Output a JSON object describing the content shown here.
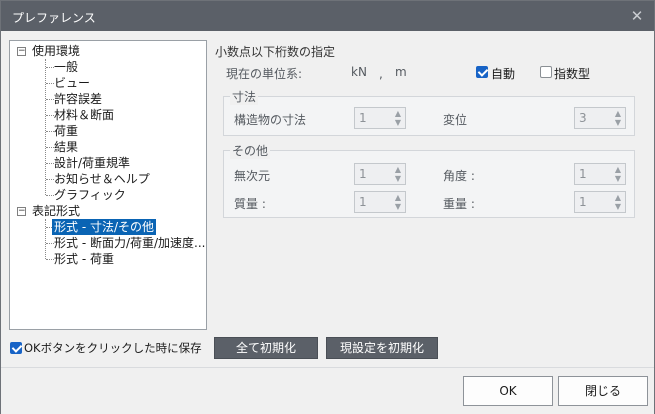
{
  "window": {
    "title": "プレファレンス"
  },
  "tree": {
    "root1": "使用環境",
    "root1_children": [
      "一般",
      "ビュー",
      "許容誤差",
      "材料＆断面",
      "荷重",
      "結果",
      "設計/荷重規準",
      "お知らせ＆ヘルプ",
      "グラフィック"
    ],
    "root2": "表記形式",
    "root2_children": [
      "形式 - 寸法/その他",
      "形式 - 断面力/荷重/加速度...",
      "形式 - 荷重"
    ],
    "selected": "形式 - 寸法/その他"
  },
  "panel": {
    "heading": "小数点以下桁数の指定",
    "unit_label": "現在の単位系:",
    "unit_force": "kN",
    "unit_sep": ",",
    "unit_length": "m",
    "auto_label": "自動",
    "auto_checked": true,
    "exp_label": "指数型",
    "exp_checked": false,
    "dim_group": {
      "title": "寸法",
      "structure_label": "構造物の寸法",
      "structure_value": "1",
      "disp_label": "変位",
      "disp_value": "3"
    },
    "other_group": {
      "title": "その他",
      "dimless_label": "無次元",
      "dimless_value": "1",
      "angle_label": "角度 :",
      "angle_value": "1",
      "mass_label": "質量 :",
      "mass_value": "1",
      "weight_label": "重量 :",
      "weight_value": "1"
    }
  },
  "bottom": {
    "save_on_ok_label": "OKボタンをクリックした時に保存",
    "save_on_ok_checked": true,
    "reset_all_label": "全て初期化",
    "reset_current_label": "現設定を初期化"
  },
  "footer": {
    "ok_label": "OK",
    "close_label": "閉じる"
  }
}
